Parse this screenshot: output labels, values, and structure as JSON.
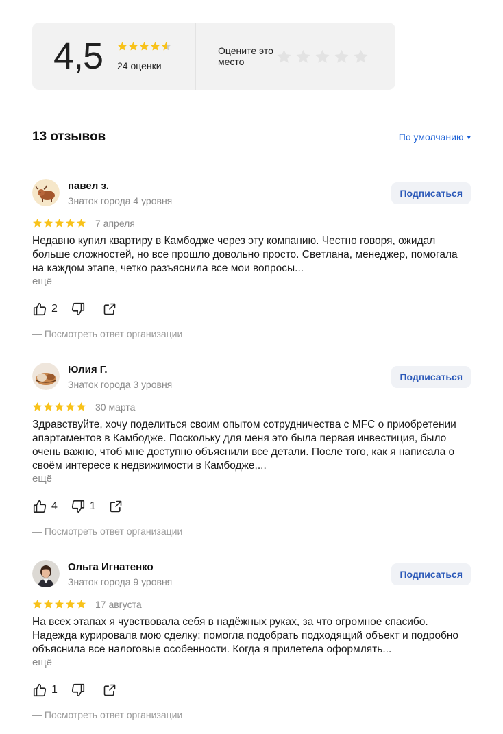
{
  "summary": {
    "score": "4,5",
    "count": "24 оценки",
    "rate_label": "Оцените это место",
    "star_fill": "#f8c21a",
    "star_empty": "#dfdfdf"
  },
  "reviews_header": {
    "count_label": "13 отзывов",
    "sort_label": "По умолчанию",
    "sort_arrow": "▾"
  },
  "reviews": [
    {
      "name": "павел з.",
      "level": "Знаток города 4 уровня",
      "subscribe": "Подписаться",
      "date": "7 апреля",
      "rating": 5,
      "text": "Недавно купил квартиру в Камбодже через эту компанию. Честно говоря, ожидал больше сложностей, но все прошло довольно просто. Светлана, менеджер, помогала на каждом этапе, четко разъяснила все мои вопросы...",
      "more": "ещё",
      "likes": "2",
      "dislikes": "",
      "org_answer": "— Посмотреть ответ организации",
      "avatar": "yak"
    },
    {
      "name": "Юлия Г.",
      "level": "Знаток города 3 уровня",
      "subscribe": "Подписаться",
      "date": "30 марта",
      "rating": 5,
      "text": "Здравствуйте, хочу поделиться своим опытом сотрудничества с MFC о приобретении апартаментов в Камбодже. Поскольку для меня это была первая инвестиция, было очень важно, чтоб мне доступно объяснили все детали. После того, как я написала о своём интересе к недвижимости в Камбодже,...",
      "more": "ещё",
      "likes": "4",
      "dislikes": "1",
      "org_answer": "— Посмотреть ответ организации",
      "avatar": "cat"
    },
    {
      "name": "Ольга Игнатенко",
      "level": "Знаток города 9 уровня",
      "subscribe": "Подписаться",
      "date": "17 августа",
      "rating": 5,
      "text": "На всех этапах я чувствовала себя в надёжных руках, за что огромное спасибо. Надежда курировала мою сделку: помогла подобрать подходящий объект и подробно объяснила все налоговые особенности. Когда я прилетела оформлять...",
      "more": "ещё",
      "likes": "1",
      "dislikes": "",
      "org_answer": "— Посмотреть ответ организации",
      "avatar": "woman"
    }
  ]
}
